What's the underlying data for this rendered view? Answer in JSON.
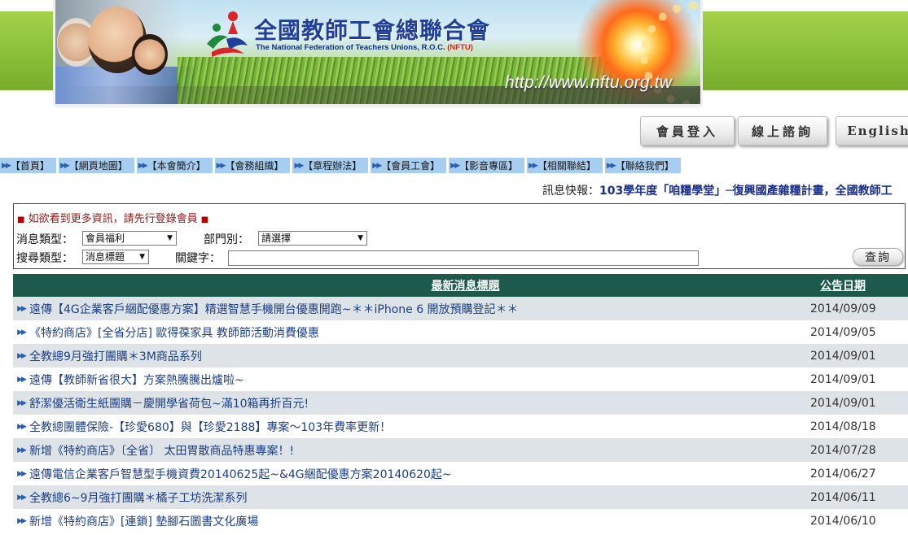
{
  "header": {
    "logo_title": "全國教師工會總聯合會",
    "logo_subtitle": "The National Federation of Teachers Unions, R.O.C.",
    "logo_tag": "(NFTU)",
    "url": "http://www.nftu.org.tw"
  },
  "top_buttons": [
    "會員登入",
    "線上諮詢",
    "English"
  ],
  "nav": [
    "【首頁】",
    "【網頁地圖】",
    "【本會簡介】",
    "【會務組織】",
    "【章程辦法】",
    "【會員工會】",
    "【影音專區】",
    "【相關聯結】",
    "【聯絡我們】"
  ],
  "marquee": {
    "label": "訊息快報：",
    "text": "103學年度「咱糧學堂」─復興國產雜糧計畫，全國教師工"
  },
  "search": {
    "notice": "如欲看到更多資訊，請先行登錄會員",
    "notice_mark": "■",
    "msg_type_label": "消息類型：",
    "msg_type_value": "會員福利",
    "dept_label": "部門別：",
    "dept_value": "請選擇",
    "search_type_label": "搜尋類型：",
    "search_type_value": "消息標題",
    "keyword_label": "關鍵字：",
    "keyword_value": "",
    "query_label": "查詢"
  },
  "table": {
    "col_title": "最新消息標題",
    "col_date": "公告日期",
    "rows": [
      {
        "title": "遠傳【4G企業客戶綑配優惠方案】精選智慧手機開台優惠開跑~＊＊iPhone 6 開放預購登記＊＊",
        "date": "2014/09/09"
      },
      {
        "title": "《特約商店》[全省分店] 歐得葆家具 教師節活動消費優惠",
        "date": "2014/09/05"
      },
      {
        "title": "全教總9月強打團購＊3M商品系列",
        "date": "2014/09/01"
      },
      {
        "title": "遠傳【教師新省很大】方案熱騰騰出爐啦~",
        "date": "2014/09/01"
      },
      {
        "title": "舒潔優活衛生紙團購－慶開學省荷包~滿10箱再折百元!",
        "date": "2014/09/01"
      },
      {
        "title": "全教總團體保險-【珍愛680】與【珍愛2188】專案～103年費率更新！",
        "date": "2014/08/18"
      },
      {
        "title": "新增《特約商店》〔全省〕 太田胃散商品特惠專案！!",
        "date": "2014/07/28"
      },
      {
        "title": "遠傳電信企業客戶智慧型手機資費20140625起~&4G綑配優惠方案20140620起~",
        "date": "2014/06/27"
      },
      {
        "title": "全教總6~9月強打團購＊橘子工坊洗潔系列",
        "date": "2014/06/11"
      },
      {
        "title": "新增《特約商店》[連鎖] 墊腳石圖書文化廣場",
        "date": "2014/06/10"
      }
    ]
  }
}
